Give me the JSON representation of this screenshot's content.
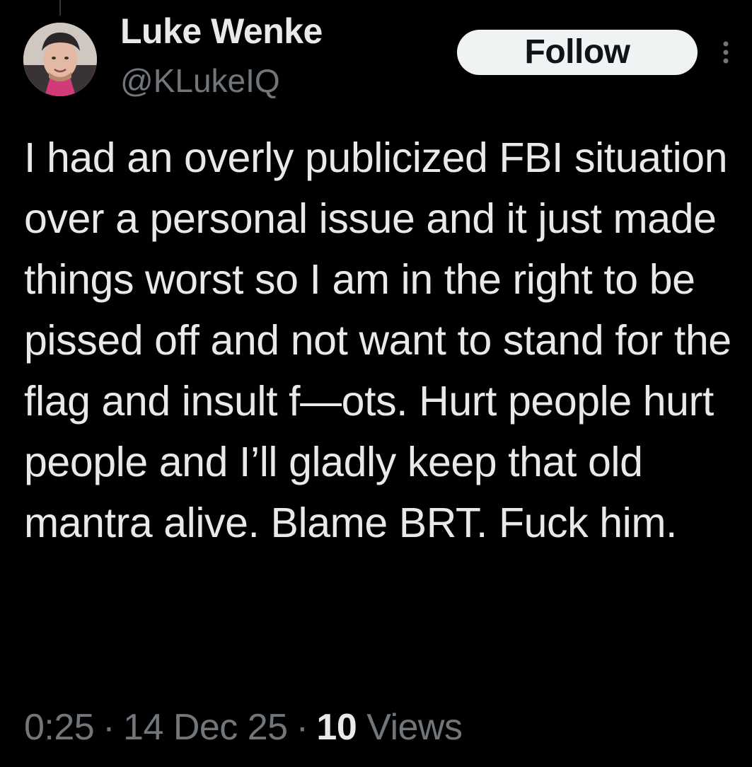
{
  "tweet": {
    "author": {
      "display_name": "Luke Wenke",
      "handle": "@KLukeIQ",
      "avatar_icon": "user-avatar"
    },
    "follow_label": "Follow",
    "more_icon": "more-vertical-icon",
    "text": "I had an overly publicized FBI situation over a personal issue and it just made things worst so I am in the right to be pissed off and not want to stand for the flag and insult f—ots.  Hurt people hurt people and I’ll gladly keep that old mantra alive.  Blame BRT. Fuck him.",
    "time": "0:25",
    "date": "14 Dec 25",
    "separator": "·",
    "views_count": "10",
    "views_label": "Views"
  },
  "colors": {
    "background": "#000000",
    "primary_text": "#e7e9ea",
    "secondary_text": "#71767b",
    "follow_bg": "#eff3f4",
    "follow_text": "#0f1419"
  }
}
